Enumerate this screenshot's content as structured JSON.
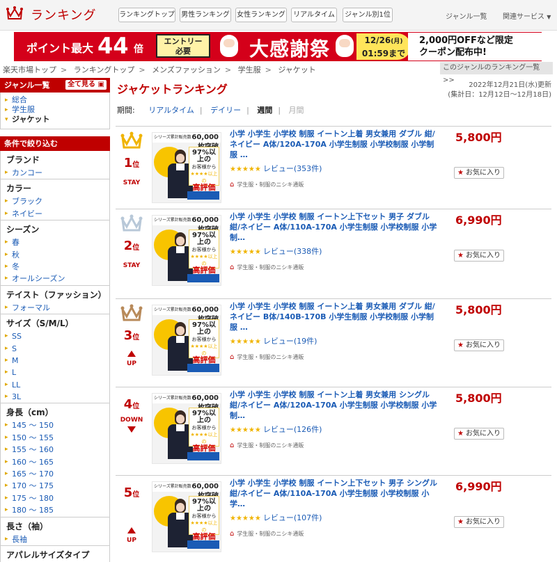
{
  "header": {
    "logo_text": "ランキング",
    "nav_buttons": [
      "ランキングトップ",
      "男性ランキング",
      "女性ランキング",
      "リアルタイム",
      "ジャンル別1位"
    ],
    "links": [
      "ジャンル一覧",
      "関連サービス"
    ]
  },
  "banner": {
    "point_text": "ポイント最大",
    "point_value": "44",
    "point_unit": "倍",
    "entry_line1": "エントリー",
    "entry_line2": "必要",
    "festival": "大感謝祭",
    "date": "12/26",
    "date_day": "(月)",
    "time": "01:59まで",
    "off_line1": "2,000円OFFなど限定",
    "off_line2": "クーポン配布中!"
  },
  "breadcrumb": [
    "楽天市場トップ",
    "ランキングトップ",
    "メンズファッション",
    "学生服",
    "ジャケット"
  ],
  "genre_ranking_link": "このジャンルのランキング一覧 >>",
  "sidebar": {
    "genre_title": "ジャンル一覧",
    "see_all": "全て見る",
    "genres": [
      "総合",
      "学生服",
      "ジャケット"
    ],
    "filter_title": "条件で絞り込む",
    "sections": [
      {
        "title": "ブランド",
        "items": [
          "カンコー"
        ]
      },
      {
        "title": "カラー",
        "items": [
          "ブラック",
          "ネイビー"
        ]
      },
      {
        "title": "シーズン",
        "items": [
          "春",
          "秋",
          "冬",
          "オールシーズン"
        ]
      },
      {
        "title": "テイスト（ファッション）",
        "items": [
          "フォーマル"
        ]
      },
      {
        "title": "サイズ（S/M/L）",
        "items": [
          "SS",
          "S",
          "M",
          "L",
          "LL",
          "3L"
        ]
      },
      {
        "title": "身長（cm）",
        "items": [
          "145 ～ 150",
          "150 ～ 155",
          "155 ～ 160",
          "160 ～ 165",
          "165 ～ 170",
          "170 ～ 175",
          "175 ～ 180",
          "180 ～ 185"
        ]
      },
      {
        "title": "長さ（袖）",
        "items": [
          "長袖"
        ]
      },
      {
        "title": "アパレルサイズタイプ",
        "items": []
      }
    ]
  },
  "main": {
    "title": "ジャケットランキング",
    "updated": "2022年12月21日(水)更新",
    "period_note": "(集計日：12月12日～12月18日)",
    "period_label": "期間:",
    "periods": [
      "リアルタイム",
      "デイリー",
      "週間",
      "月間"
    ],
    "favorite_label": "お気に入り",
    "thumb": {
      "top_small": "シリーズ累計販売数",
      "top_big": "60,000枚突破",
      "pct": "97%以上の",
      "line2": "お客様から",
      "stars": "★★★★以上の",
      "hi": "高評価"
    },
    "items": [
      {
        "rank": "1",
        "rank_suffix": "位",
        "trend": "STAY",
        "title": "小学 小学生 小学校 制服 イートン上着 男女兼用 ダブル 紺/ネイビー A体/120A-170A 小学生制服 小学校制服 小学制服 …",
        "reviews": "レビュー(353件)",
        "shop": "学生服・制服のニシキ通販",
        "price": "5,800円"
      },
      {
        "rank": "2",
        "rank_suffix": "位",
        "trend": "STAY",
        "title": "小学 小学生 小学校 制服 イートン上下セット 男子 ダブル 紺/ネイビー A体/110A-170A 小学生制服 小学校制服 小学制…",
        "reviews": "レビュー(338件)",
        "shop": "学生服・制服のニシキ通販",
        "price": "6,990円"
      },
      {
        "rank": "3",
        "rank_suffix": "位",
        "trend": "UP",
        "title": "小学 小学生 小学校 制服 イートン上着 男女兼用 ダブル 紺/ネイビー B体/140B-170B 小学生制服 小学校制服 小学制服 …",
        "reviews": "レビュー(19件)",
        "shop": "学生服・制服のニシキ通販",
        "price": "5,800円"
      },
      {
        "rank": "4",
        "rank_suffix": "位",
        "trend": "DOWN",
        "title": "小学 小学生 小学校 制服 イートン上着 男女兼用 シングル 紺/ネイビー A体/120A-170A 小学生制服 小学校制服 小学制…",
        "reviews": "レビュー(126件)",
        "shop": "学生服・制服のニシキ通販",
        "price": "5,800円"
      },
      {
        "rank": "5",
        "rank_suffix": "位",
        "trend": "UP",
        "title": "小学 小学生 小学校 制服 イートン上下セット 男子 シングル 紺/ネイビー A体/110A-170A 小学生制服 小学校制服 小学…",
        "reviews": "レビュー(107件)",
        "shop": "学生服・制服のニシキ通販",
        "price": "6,990円"
      }
    ]
  },
  "colors": {
    "brand_red": "#bf0000",
    "link_blue": "#1a5bb5",
    "gold_crown": "#f0b400",
    "silver_crown": "#b8c8d8",
    "bronze_crown": "#b88a5a"
  }
}
